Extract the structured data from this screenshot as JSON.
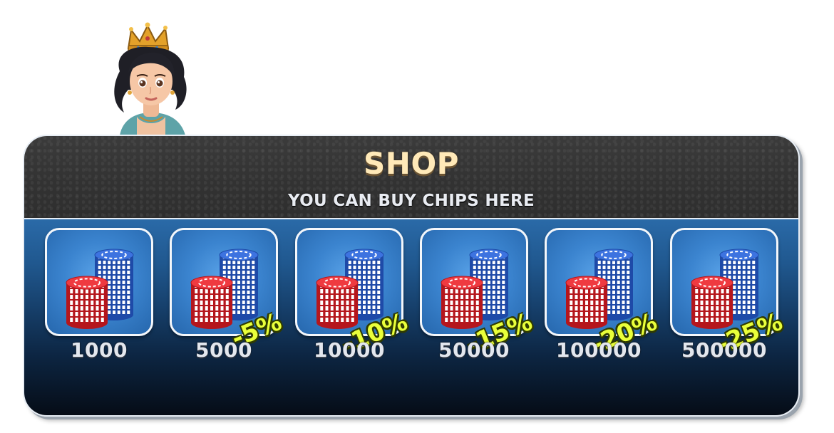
{
  "shop": {
    "title": "SHOP",
    "subtitle": "YOU CAN BUY CHIPS HERE"
  },
  "avatar": {
    "icon": "queen-avatar-icon"
  },
  "colors": {
    "title": "#ffe9b8",
    "subtitle": "#e9ecf2",
    "discount": "#e9ff3a",
    "panel_top": "#2a6aa8",
    "panel_bottom": "#050b14",
    "chip_red": "#e0262e",
    "chip_blue": "#2a5fd0"
  },
  "items": [
    {
      "amount": "1000",
      "discount": ""
    },
    {
      "amount": "5000",
      "discount": "-5%"
    },
    {
      "amount": "10000",
      "discount": "-10%"
    },
    {
      "amount": "50000",
      "discount": "-15%"
    },
    {
      "amount": "100000",
      "discount": "-20%"
    },
    {
      "amount": "500000",
      "discount": "-25%"
    }
  ]
}
